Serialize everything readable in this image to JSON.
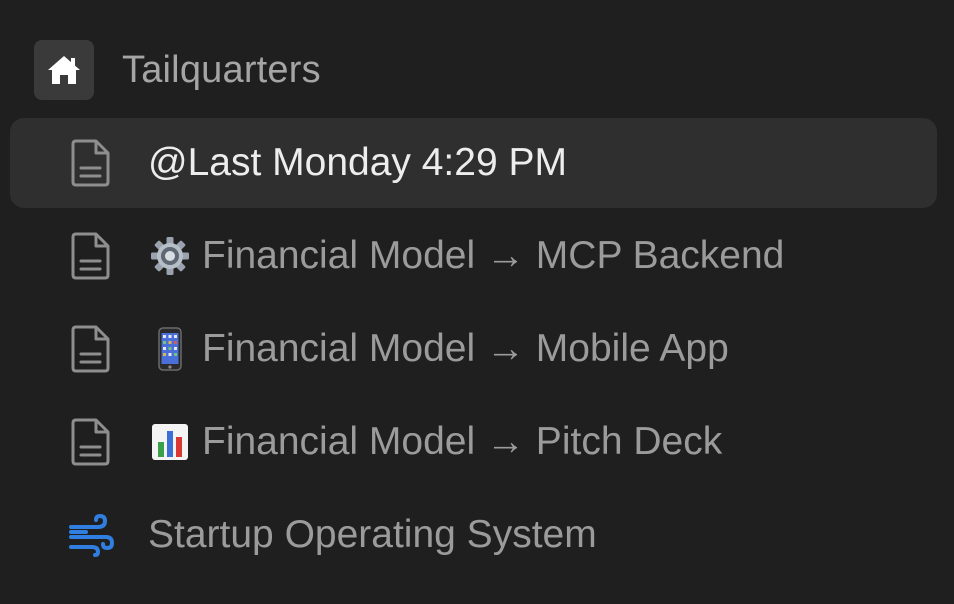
{
  "workspace": {
    "name": "Tailquarters",
    "icon": "home-icon"
  },
  "items": [
    {
      "label": "@Last Monday 4:29 PM",
      "icon": "document-icon",
      "emoji": ""
    },
    {
      "label": "Financial Model → MCP Backend",
      "icon": "document-icon",
      "emoji": "gear-emoji"
    },
    {
      "label": "Financial Model → Mobile App",
      "icon": "document-icon",
      "emoji": "mobile-phone-emoji"
    },
    {
      "label": "Financial Model → Pitch Deck",
      "icon": "document-icon",
      "emoji": "bar-chart-emoji"
    },
    {
      "label": "Startup Operating System",
      "icon": "wind-icon",
      "emoji": ""
    }
  ],
  "colors": {
    "background": "#1f1f1f",
    "selected_row": "#2f2f2f",
    "text_muted": "#9b9b9b",
    "text_selected": "#ededed",
    "accent_blue": "#2f7ee0"
  }
}
